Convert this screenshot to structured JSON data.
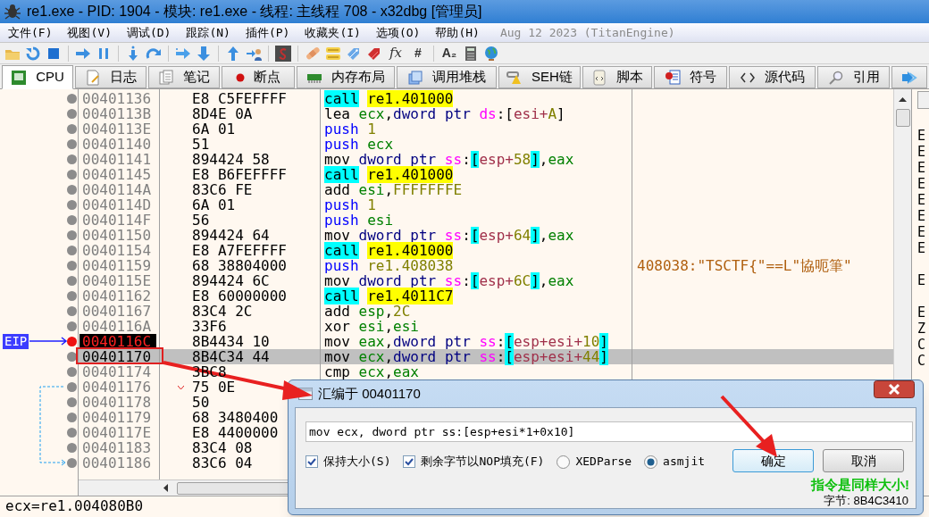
{
  "window": {
    "title": "re1.exe - PID: 1904 - 模块: re1.exe - 线程: 主线程 708 - x32dbg [管理员]"
  },
  "menu": [
    "文件(F)",
    "视图(V)",
    "调试(D)",
    "跟踪(N)",
    "插件(P)",
    "收藏夹(I)",
    "选项(O)",
    "帮助(H)"
  ],
  "build_info": "Aug 12 2023 (TitanEngine)",
  "toolbar": {
    "glyphs": [
      "fx",
      "#",
      "A₂"
    ]
  },
  "tabs": [
    {
      "label": "CPU",
      "selected": true
    },
    {
      "label": "日志",
      "selected": false
    },
    {
      "label": "笔记",
      "selected": false
    },
    {
      "label": "断点",
      "selected": false
    },
    {
      "label": "内存布局",
      "selected": false
    },
    {
      "label": "调用堆栈",
      "selected": false
    },
    {
      "label": "SEH链",
      "selected": false
    },
    {
      "label": "脚本",
      "selected": false
    },
    {
      "label": "符号",
      "selected": false
    },
    {
      "label": "源代码",
      "selected": false
    },
    {
      "label": "引用",
      "selected": false
    },
    {
      "selected": false
    }
  ],
  "eip_label": "EIP",
  "rows": [
    {
      "address": "00401136",
      "bytes": "E8 C5FEFFFF",
      "instruction": [
        {
          "kind": "call",
          "text": "call"
        },
        {
          "kind": "label",
          "text": "re1.401000"
        }
      ],
      "selected": false,
      "eip": false
    },
    {
      "address": "0040113B",
      "bytes": "8D4E 0A",
      "instruction": [
        {
          "kind": "op",
          "text": "lea "
        },
        {
          "kind": "reg",
          "text": "ecx"
        },
        {
          "kind": "p",
          "text": ","
        },
        {
          "kind": "size",
          "text": "dword ptr "
        },
        {
          "kind": "seg",
          "text": "ds"
        },
        {
          "kind": "p",
          "text": ":["
        },
        {
          "kind": "mreg",
          "text": "esi+"
        },
        {
          "kind": "num",
          "text": "A"
        },
        {
          "kind": "p",
          "text": "]"
        }
      ],
      "selected": false,
      "eip": false
    },
    {
      "address": "0040113E",
      "bytes": "6A 01",
      "instruction": [
        {
          "kind": "push",
          "text": "push "
        },
        {
          "kind": "num",
          "text": "1"
        }
      ],
      "selected": false,
      "eip": false
    },
    {
      "address": "00401140",
      "bytes": "51",
      "instruction": [
        {
          "kind": "push",
          "text": "push "
        },
        {
          "kind": "reg",
          "text": "ecx"
        }
      ],
      "selected": false,
      "eip": false
    },
    {
      "address": "00401141",
      "bytes": "894424 58",
      "instruction": [
        {
          "kind": "op",
          "text": "mov "
        },
        {
          "kind": "size",
          "text": "dword ptr "
        },
        {
          "kind": "seg",
          "text": "ss"
        },
        {
          "kind": "p",
          "text": ":"
        },
        {
          "kind": "br",
          "text": "["
        },
        {
          "kind": "mreg",
          "text": "esp+"
        },
        {
          "kind": "num",
          "text": "58"
        },
        {
          "kind": "br",
          "text": "]"
        },
        {
          "kind": "p",
          "text": ","
        },
        {
          "kind": "reg",
          "text": "eax"
        }
      ],
      "selected": false,
      "eip": false
    },
    {
      "address": "00401145",
      "bytes": "E8 B6FEFFFF",
      "instruction": [
        {
          "kind": "call",
          "text": "call"
        },
        {
          "kind": "label",
          "text": "re1.401000"
        }
      ],
      "selected": false,
      "eip": false
    },
    {
      "address": "0040114A",
      "bytes": "83C6 FE",
      "instruction": [
        {
          "kind": "op",
          "text": "add "
        },
        {
          "kind": "reg",
          "text": "esi"
        },
        {
          "kind": "p",
          "text": ","
        },
        {
          "kind": "num",
          "text": "FFFFFFFE"
        }
      ],
      "selected": false,
      "eip": false
    },
    {
      "address": "0040114D",
      "bytes": "6A 01",
      "instruction": [
        {
          "kind": "push",
          "text": "push "
        },
        {
          "kind": "num",
          "text": "1"
        }
      ],
      "selected": false,
      "eip": false
    },
    {
      "address": "0040114F",
      "bytes": "56",
      "instruction": [
        {
          "kind": "push",
          "text": "push "
        },
        {
          "kind": "reg",
          "text": "esi"
        }
      ],
      "selected": false,
      "eip": false
    },
    {
      "address": "00401150",
      "bytes": "894424 64",
      "instruction": [
        {
          "kind": "op",
          "text": "mov "
        },
        {
          "kind": "size",
          "text": "dword ptr "
        },
        {
          "kind": "seg",
          "text": "ss"
        },
        {
          "kind": "p",
          "text": ":"
        },
        {
          "kind": "br",
          "text": "["
        },
        {
          "kind": "mreg",
          "text": "esp+"
        },
        {
          "kind": "num",
          "text": "64"
        },
        {
          "kind": "br",
          "text": "]"
        },
        {
          "kind": "p",
          "text": ","
        },
        {
          "kind": "reg",
          "text": "eax"
        }
      ],
      "selected": false,
      "eip": false
    },
    {
      "address": "00401154",
      "bytes": "E8 A7FEFFFF",
      "instruction": [
        {
          "kind": "call",
          "text": "call"
        },
        {
          "kind": "label",
          "text": "re1.401000"
        }
      ],
      "selected": false,
      "eip": false
    },
    {
      "address": "00401159",
      "bytes": "68 38804000",
      "instruction": [
        {
          "kind": "push",
          "text": "push "
        },
        {
          "kind": "num",
          "text": "re1.408038"
        }
      ],
      "comment": "408038:\"TSCTF{\"==L\"協呃筆\"",
      "selected": false,
      "eip": false
    },
    {
      "address": "0040115E",
      "bytes": "894424 6C",
      "instruction": [
        {
          "kind": "op",
          "text": "mov "
        },
        {
          "kind": "size",
          "text": "dword ptr "
        },
        {
          "kind": "seg",
          "text": "ss"
        },
        {
          "kind": "p",
          "text": ":"
        },
        {
          "kind": "br",
          "text": "["
        },
        {
          "kind": "mreg",
          "text": "esp+"
        },
        {
          "kind": "num",
          "text": "6C"
        },
        {
          "kind": "br",
          "text": "]"
        },
        {
          "kind": "p",
          "text": ","
        },
        {
          "kind": "reg",
          "text": "eax"
        }
      ],
      "selected": false,
      "eip": false
    },
    {
      "address": "00401162",
      "bytes": "E8 60000000",
      "instruction": [
        {
          "kind": "call",
          "text": "call"
        },
        {
          "kind": "label",
          "text": "re1.4011C7"
        }
      ],
      "selected": false,
      "eip": false
    },
    {
      "address": "00401167",
      "bytes": "83C4 2C",
      "instruction": [
        {
          "kind": "op",
          "text": "add "
        },
        {
          "kind": "reg",
          "text": "esp"
        },
        {
          "kind": "p",
          "text": ","
        },
        {
          "kind": "num",
          "text": "2C"
        }
      ],
      "selected": false,
      "eip": false
    },
    {
      "address": "0040116A",
      "bytes": "33F6",
      "instruction": [
        {
          "kind": "op",
          "text": "xor "
        },
        {
          "kind": "reg",
          "text": "esi"
        },
        {
          "kind": "p",
          "text": ","
        },
        {
          "kind": "reg",
          "text": "esi"
        }
      ],
      "selected": false,
      "eip": false
    },
    {
      "address": "0040116C",
      "bytes": "8B4434 10",
      "instruction": [
        {
          "kind": "op",
          "text": "mov "
        },
        {
          "kind": "reg",
          "text": "eax"
        },
        {
          "kind": "p",
          "text": ","
        },
        {
          "kind": "size",
          "text": "dword ptr "
        },
        {
          "kind": "seg",
          "text": "ss"
        },
        {
          "kind": "p",
          "text": ":"
        },
        {
          "kind": "br",
          "text": "["
        },
        {
          "kind": "mreg",
          "text": "esp+esi+"
        },
        {
          "kind": "num",
          "text": "10"
        },
        {
          "kind": "br",
          "text": "]"
        }
      ],
      "selected": false,
      "eip": true
    },
    {
      "address": "00401170",
      "bytes": "8B4C34 44",
      "instruction": [
        {
          "kind": "op",
          "text": "mov "
        },
        {
          "kind": "reg",
          "text": "ecx"
        },
        {
          "kind": "p",
          "text": ","
        },
        {
          "kind": "size",
          "text": "dword ptr "
        },
        {
          "kind": "seg",
          "text": "ss"
        },
        {
          "kind": "p",
          "text": ":"
        },
        {
          "kind": "br",
          "text": "["
        },
        {
          "kind": "mreg",
          "text": "esp+esi+"
        },
        {
          "kind": "num",
          "text": "44"
        },
        {
          "kind": "br",
          "text": "]"
        }
      ],
      "selected": true,
      "eip": false
    },
    {
      "address": "00401174",
      "bytes": "3BC8",
      "instruction": [
        {
          "kind": "op",
          "text": "cmp "
        },
        {
          "kind": "reg",
          "text": "ecx"
        },
        {
          "kind": "p",
          "text": ","
        },
        {
          "kind": "reg",
          "text": "eax"
        }
      ],
      "selected": false,
      "eip": false
    },
    {
      "address": "00401176",
      "bytes": "75 0E",
      "jump_source": true,
      "selected": false,
      "eip": false
    },
    {
      "address": "00401178",
      "bytes": "50",
      "selected": false,
      "eip": false
    },
    {
      "address": "00401179",
      "bytes": "68 3480400",
      "selected": false,
      "eip": false
    },
    {
      "address": "0040117E",
      "bytes": "E8 4400000",
      "selected": false,
      "eip": false
    },
    {
      "address": "00401183",
      "bytes": "83C4 08",
      "selected": false,
      "eip": false
    },
    {
      "address": "00401186",
      "bytes": "83C6 04",
      "jump_target": true,
      "selected": false,
      "eip": false
    }
  ],
  "registers": [
    [
      "E",
      "E",
      "E",
      "E",
      "E",
      "E",
      "E",
      "E"
    ],
    [
      "E"
    ],
    [
      "E",
      "Z",
      "C",
      "C"
    ]
  ],
  "status_bar": "ecx=re1.004080B0",
  "dialog": {
    "title": "汇编于 00401170",
    "input": "mov ecx, dword ptr ss:[esp+esi*1+0x10]",
    "options": [
      {
        "kind": "checkbox",
        "label": "保持大小(S)",
        "checked": true
      },
      {
        "kind": "checkbox",
        "label": "剩余字节以NOP填充(F)",
        "checked": true
      },
      {
        "kind": "radio",
        "label": "XEDParse",
        "selected": false
      },
      {
        "kind": "radio",
        "label": "asmjit",
        "selected": true
      }
    ],
    "buttons": [
      {
        "label": "确定",
        "focused": true
      },
      {
        "label": "取消",
        "focused": false
      }
    ],
    "message": "指令是同样大小!",
    "bytes": "字节: 8B4C3410"
  }
}
